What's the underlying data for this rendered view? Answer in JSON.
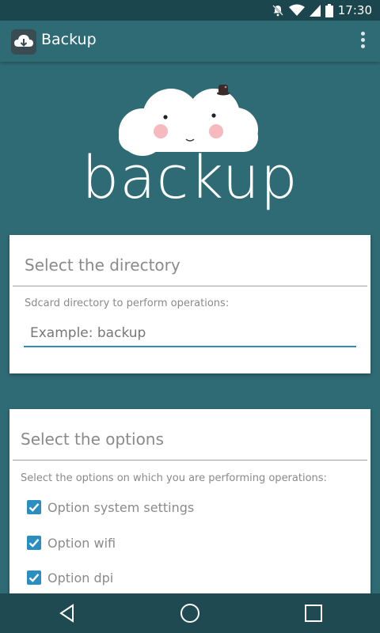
{
  "status_bar": {
    "time": "17:30",
    "icons": [
      "notifications-off-icon",
      "wifi-icon",
      "signal-icon",
      "battery-icon"
    ]
  },
  "app_bar": {
    "title": "Backup",
    "icon": "cloud-download-icon",
    "menu_icon": "overflow-menu-icon"
  },
  "hero": {
    "wordmark": "backup",
    "illustration": "cloud-mascot"
  },
  "directory_card": {
    "title": "Select the directory",
    "description": "Sdcard directory to perform operations:",
    "input_placeholder": "Example: backup",
    "input_value": ""
  },
  "options_card": {
    "title": "Select the options",
    "description": "Select the options on which you are performing operations:",
    "options": [
      {
        "label": "Option system settings",
        "checked": true
      },
      {
        "label": "Option wifi",
        "checked": true
      },
      {
        "label": "Option dpi",
        "checked": true
      }
    ]
  },
  "nav_bar": {
    "buttons": [
      "back-icon",
      "home-icon",
      "recents-icon"
    ]
  },
  "colors": {
    "background": "#2f6b75",
    "status_bar": "#1b464e",
    "accent": "#2a8fc0",
    "nav_bar": "#1f4a52"
  }
}
